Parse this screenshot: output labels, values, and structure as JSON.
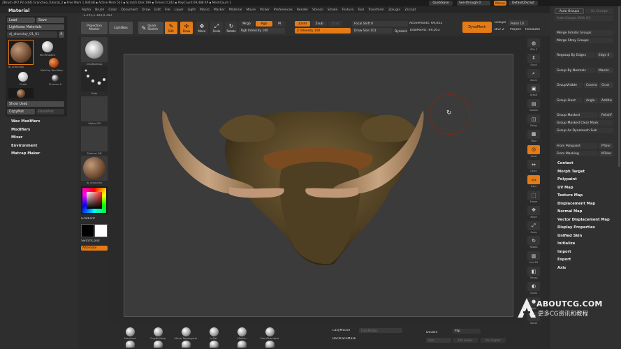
{
  "titlebar": {
    "text": "ZBrush 4R7 P2 (x64)   Grancheo_Tutorial_2   ▪ Free Mem 1.934GB ▪ Active Mem 523 ▪ Scratch Disk 199 ▪ Timers 0.242 ▪ PolyCount 69,488 KP ▪ MeshCount 1",
    "quicksave": "QuickSave",
    "seethrough": "See-through  0",
    "menus": "Menus",
    "defaultzscript": "DefaultZScript"
  },
  "menubar": {
    "palette_title": "Material",
    "items": [
      "Alpha",
      "Brush",
      "Color",
      "Document",
      "Draw",
      "Edit",
      "File",
      "Layer",
      "Light",
      "Macro",
      "Marker",
      "Material",
      "Movie",
      "Picker",
      "Preferences",
      "Render",
      "Stencil",
      "Stroke",
      "Texture",
      "Tool",
      "Transform",
      "Zplugin",
      "Zscript"
    ]
  },
  "coords": "-2.291,1.184,0.343",
  "toolbar": {
    "projection_master": "Projection Master",
    "lightbox": "LightBox",
    "quick_sketch": "Quick Sketch",
    "edit": "Edit",
    "draw": "Draw",
    "move": "Move",
    "scale": "Scale",
    "rotate": "Rotate",
    "mrgb": "Mrgb",
    "rgb": "Rgb",
    "m": "M",
    "zadd": "Zadd",
    "zsub": "Zsub",
    "zcut": "Zcut",
    "rgb_intensity": "Rgb Intensity 100",
    "z_intensity": "Z Intensity 100",
    "focal_shift": "Focal Shift 0",
    "draw_size": "Draw Size 101",
    "dynamic": "Dynamic",
    "active_points": "ActivePoints: 69,053",
    "total_points": "TotalPoints: 69,053",
    "dynamesh": "DynaMesh",
    "groups": "Groups",
    "polish": "Polish 10",
    "blur": "Blur 2",
    "project": "Project",
    "resolution": "Resolutio"
  },
  "left_panel": {
    "load": "Load",
    "save": "Save",
    "lightbox_materials": "Lightbox▸ Materials",
    "material_name": "dj_shonclay_01_01",
    "material_num": "R",
    "materials": [
      {
        "label": "dj_shonclay",
        "kind": "clay"
      },
      {
        "label": "SkinShade4",
        "kind": "white"
      },
      {
        "label": "MatCap Red Wax",
        "kind": "red"
      },
      {
        "label": "Chalk",
        "kind": "white"
      },
      {
        "label": "Chrome A",
        "kind": "chrome"
      }
    ],
    "show_used": "Show Used",
    "copymat": "CopyMat",
    "pastemat": "PasteMat",
    "sections": [
      "Wax Modifiers",
      "Modifiers",
      "Mixer",
      "Environment",
      "Matcap Maker"
    ]
  },
  "shelf": {
    "brush_label": "ClayBuildup",
    "stroke_label": "Dots",
    "alpha_label": "Alpha Off",
    "texture_label": "Texture Off",
    "material_label": "dj_shonclay",
    "gradient": "Gradient",
    "switchcolor": "SwitchColor",
    "alternate": "Alternate"
  },
  "right_shelf": {
    "buttons": [
      "SPix 3",
      "Scroll",
      "Zoom",
      "Actual",
      "AAHalf",
      "Persp",
      "Floor",
      "Local",
      "LSym",
      "Gxyz",
      "Frame",
      "Move",
      "Scale",
      "Rotate",
      "Line Fill",
      "Transp",
      "Ghost",
      "Solo",
      "Xpose"
    ]
  },
  "right_panel": {
    "auto_groups": "Auto Groups",
    "uv_groups": "Uv Groups",
    "auto_groups_uv": "Auto Groups With UV",
    "merge_similar": "Merge Similar Groups",
    "merge_stray": "Merge Stray Groups",
    "regroup_edges": "Regroup By Edges",
    "edge_s": "Edge S",
    "group_normals": "Group By Normals",
    "max_an": "MaxAn",
    "group_visible": "GroupVisible",
    "coverage": "Covera",
    "clust": "Clust",
    "group_front": "Group Front",
    "angle": "Angle",
    "additive": "Additiv",
    "group_masked": "Group Masked",
    "polish": "PolishF",
    "group_masked_clear": "Group Masked Clear Mask",
    "group_dynamesh": "Group As Dynamesh Sub",
    "from_polypaint": "From Polypaint",
    "ptoler": "PToler",
    "from_masking": "From Masking",
    "mtoler": "MToler",
    "sections": [
      "Contact",
      "Morph Target",
      "Polypaint",
      "UV Map",
      "Texture Map",
      "Displacement Map",
      "Normal Map",
      "Vector Displacement Map",
      "Display Properties",
      "Unified Skin",
      "Initialize",
      "Import",
      "Export",
      "Axis"
    ]
  },
  "bottom": {
    "brushes": [
      "Standard",
      "ClayBuildup",
      "Move Topological",
      "Inflat",
      "hPolish",
      "DamStandard"
    ],
    "lazymouse": "LazyMouse",
    "lazyradius": "LazyRadius",
    "backfacemask": "BackFaceMask",
    "double": "Double",
    "flip": "Flip",
    "size": "Size",
    "del_lower": "Del Lower",
    "del_higher": "Del Higher"
  },
  "watermark": {
    "title": "ABOUTCG.COM",
    "subtitle": "更多CG资讯和教程"
  },
  "colors": {
    "accent": "#e47b16",
    "panel": "#303030",
    "canvas": "#3a3a3a"
  }
}
